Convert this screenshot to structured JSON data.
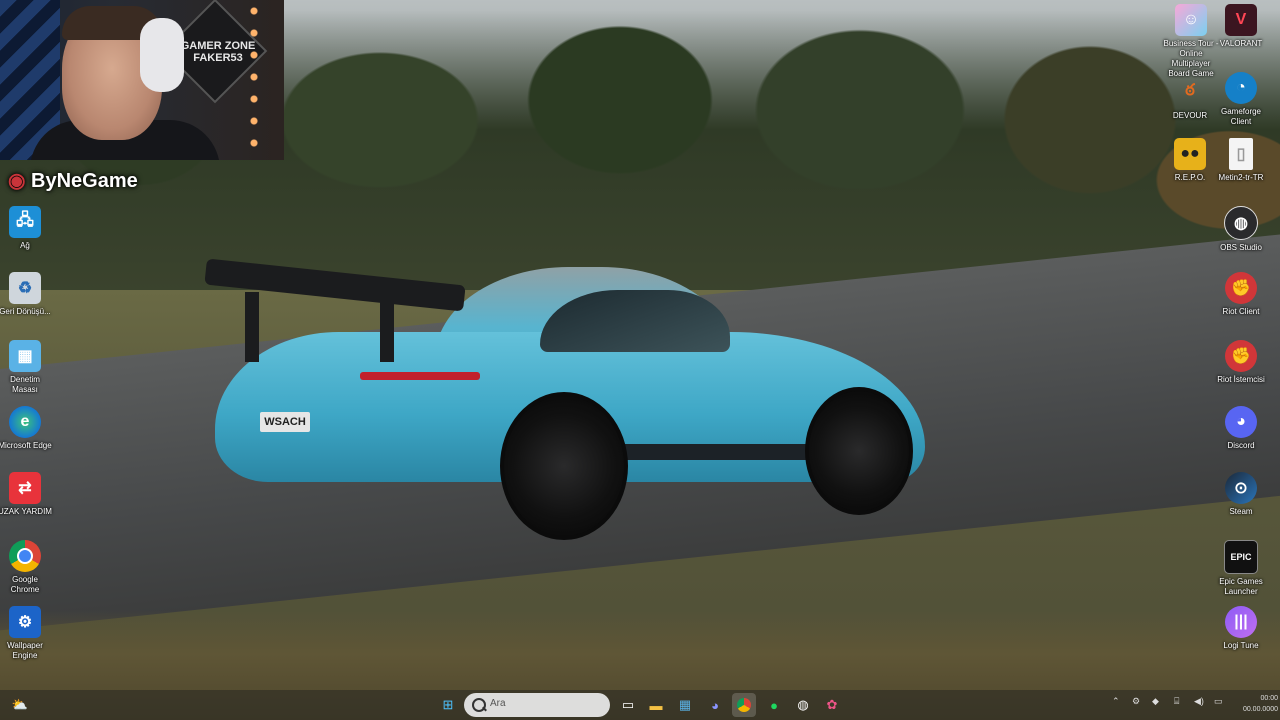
{
  "overlay": {
    "webcam_sign": "GAMER ZONE FAKER53",
    "watermark": "ByNeGame"
  },
  "desktop_left": [
    {
      "label": "Ağ",
      "icon": "network-icon"
    },
    {
      "label": "Geri Dönüşü...",
      "icon": "recycle-bin-icon"
    },
    {
      "label": "Denetim Masası",
      "icon": "control-panel-icon"
    },
    {
      "label": "Microsoft Edge",
      "icon": "edge-icon"
    },
    {
      "label": "UZAK YARDIM",
      "icon": "remote-help-icon"
    },
    {
      "label": "Google Chrome",
      "icon": "chrome-icon"
    },
    {
      "label": "Wallpaper Engine",
      "icon": "wallpaper-engine-icon"
    }
  ],
  "desktop_right": [
    {
      "label": "Business Tour - Online Multiplayer Board Game",
      "icon": "business-tour-icon"
    },
    {
      "label": "VALORANT",
      "icon": "valorant-icon"
    },
    {
      "label": "DEVOUR",
      "icon": "devour-icon"
    },
    {
      "label": "Gameforge Client",
      "icon": "gameforge-icon"
    },
    {
      "label": "R.E.P.O.",
      "icon": "repo-icon"
    },
    {
      "label": "Metin2-tr-TR",
      "icon": "file-icon"
    },
    {
      "label": "OBS Studio",
      "icon": "obs-icon"
    },
    {
      "label": "Riot Client",
      "icon": "riot-client-icon"
    },
    {
      "label": "Riot İstemcisi",
      "icon": "riot-istemcisi-icon"
    },
    {
      "label": "Discord",
      "icon": "discord-icon"
    },
    {
      "label": "Steam",
      "icon": "steam-icon"
    },
    {
      "label": "Epic Games Launcher",
      "icon": "epic-games-icon"
    },
    {
      "label": "Logi Tune",
      "icon": "logi-tune-icon"
    }
  ],
  "car": {
    "plate": "WSACH"
  },
  "taskbar": {
    "search_placeholder": "Ara",
    "pinned": [
      "windows-start-icon",
      "file-explorer-icon",
      "store-icon",
      "discord-icon",
      "chrome-icon",
      "spotify-icon",
      "obs-icon",
      "app-icon"
    ],
    "clock_time": "00:00",
    "clock_date": "00.00.0000"
  }
}
